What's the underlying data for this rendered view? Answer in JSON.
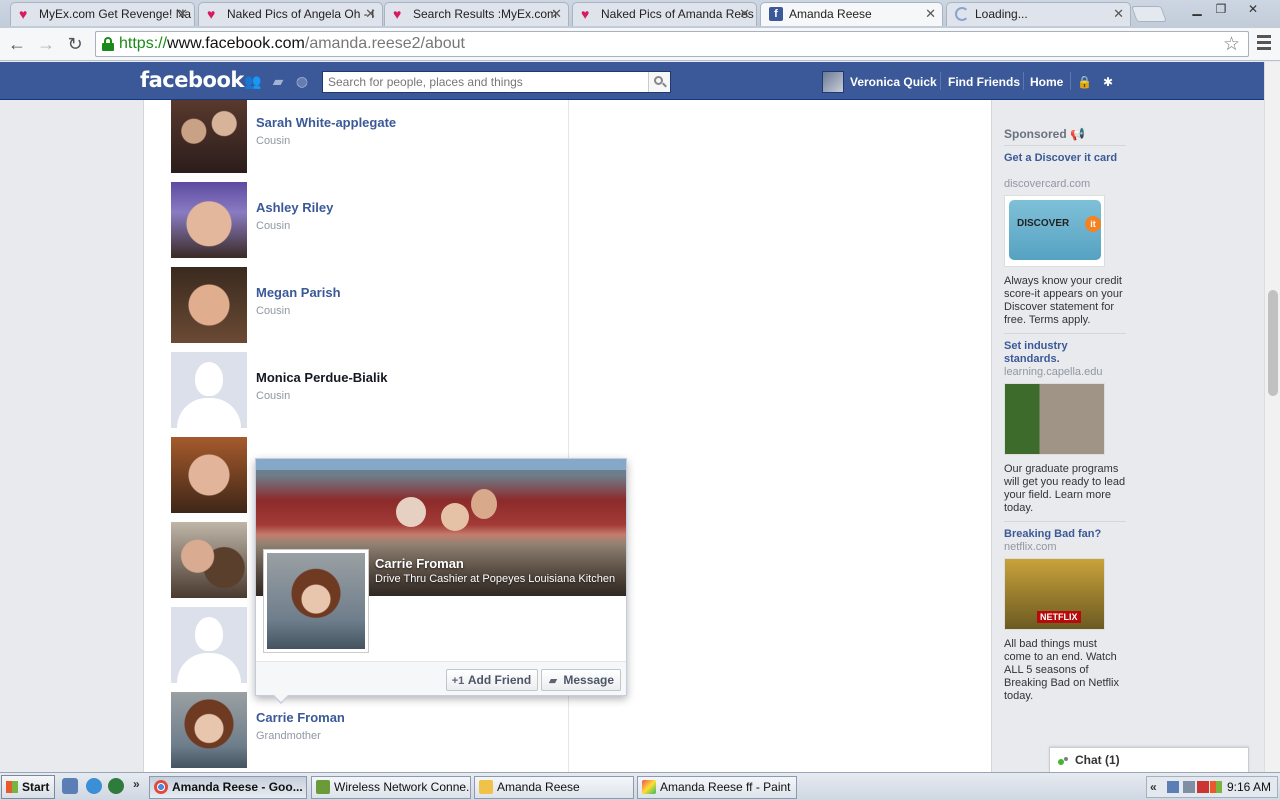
{
  "browser": {
    "tabs": [
      {
        "title": "MyEx.com Get Revenge! Na",
        "icon": "heart-icon"
      },
      {
        "title": "Naked Pics of Angela Oh - I",
        "icon": "heart-icon"
      },
      {
        "title": "Search Results :MyEx.com",
        "icon": "heart-icon"
      },
      {
        "title": "Naked Pics of Amanda Rees",
        "icon": "heart-icon"
      },
      {
        "title": "Amanda Reese",
        "icon": "facebook-icon",
        "active": true
      },
      {
        "title": "Loading...",
        "icon": "loading-icon"
      }
    ],
    "url": {
      "scheme": "https://",
      "host": "www.facebook.com",
      "path": "/amanda.reese2/about"
    }
  },
  "fb": {
    "logo": "facebook",
    "search_placeholder": "Search for people, places and things",
    "user_name": "Veronica Quick",
    "find_friends": "Find Friends",
    "home": "Home",
    "brand_color": "#3b5998"
  },
  "family": [
    {
      "name": "Sarah White-applegate",
      "relation": "Cousin",
      "linked": true
    },
    {
      "name": "Ashley Riley",
      "relation": "Cousin",
      "linked": true
    },
    {
      "name": "Megan Parish",
      "relation": "Cousin",
      "linked": true
    },
    {
      "name": "Monica Perdue-Bialik",
      "relation": "Cousin",
      "linked": false,
      "default_photo": true
    },
    {
      "name": "Carrie Froman",
      "relation": "Grandmother",
      "linked": true
    }
  ],
  "hovercard": {
    "name": "Carrie Froman",
    "job": "Drive Thru Cashier at Popeyes Louisiana Kitchen",
    "add_friend": "Add Friend",
    "message": "Message"
  },
  "ads": {
    "sponsored_label": "Sponsored",
    "items": [
      {
        "title": "Get a Discover it card",
        "host": "discovercard.com",
        "image_text": "DISCOVER",
        "image_badge": "it",
        "body": "Always know your credit score-it appears on your Discover statement for free. Terms apply."
      },
      {
        "title": "Set industry standards.",
        "host": "learning.capella.edu",
        "body": "Our graduate programs will get you ready to lead your field. Learn more today."
      },
      {
        "title": "Breaking Bad fan?",
        "host": "netflix.com",
        "image_text": "NETFLIX",
        "body": "All bad things must come to an end. Watch ALL 5 seasons of Breaking Bad on Netflix today."
      }
    ]
  },
  "chat": {
    "label": "Chat (1)"
  },
  "taskbar": {
    "start": "Start",
    "windows": [
      {
        "label": "Amanda Reese - Goo...",
        "active": true
      },
      {
        "label": "Wireless Network Conne..."
      },
      {
        "label": "Amanda Reese"
      },
      {
        "label": "Amanda Reese ff - Paint"
      }
    ],
    "overflow": "»",
    "tray_expand": "«",
    "clock": "9:16 AM"
  }
}
